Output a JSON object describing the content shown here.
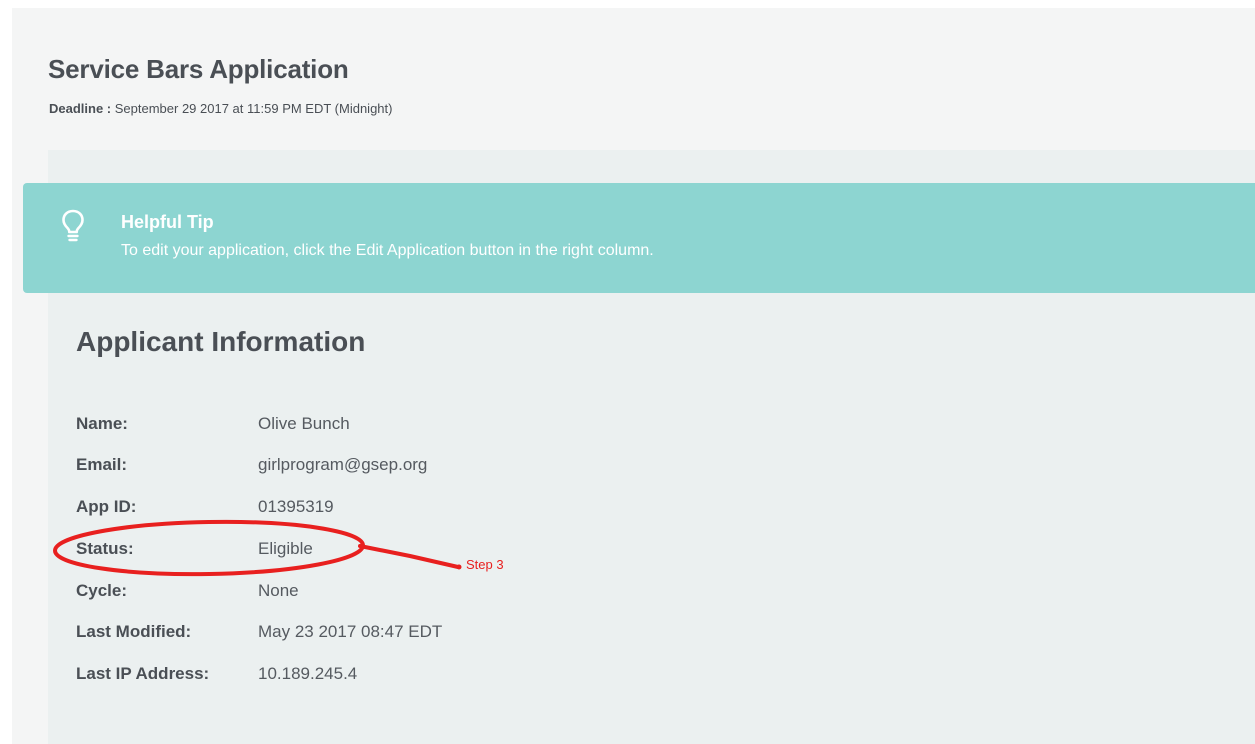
{
  "header": {
    "title": "Service Bars Application",
    "deadline_label": "Deadline :",
    "deadline_value": "September 29 2017 at 11:59 PM EDT (Midnight)"
  },
  "tip": {
    "icon": "lightbulb-icon",
    "title": "Helpful Tip",
    "text": "To edit your application, click the Edit Application button in the right column."
  },
  "applicant": {
    "section_title": "Applicant Information",
    "fields": [
      {
        "label": "Name:",
        "value": "Olive Bunch"
      },
      {
        "label": "Email:",
        "value": "girlprogram@gsep.org"
      },
      {
        "label": "App ID:",
        "value": "01395319"
      },
      {
        "label": "Status:",
        "value": "Eligible"
      },
      {
        "label": "Cycle:",
        "value": "None"
      },
      {
        "label": "Last Modified:",
        "value": "May 23 2017 08:47 EDT"
      },
      {
        "label": "Last IP Address:",
        "value": "10.189.245.4"
      }
    ]
  },
  "annotation": {
    "step_label": "Step 3",
    "color": "#e8201f"
  },
  "colors": {
    "tip_background": "#8dd5d1",
    "panel_background": "#ebf0f0",
    "page_background": "#f4f5f5",
    "text_dark": "#4a4f55"
  }
}
